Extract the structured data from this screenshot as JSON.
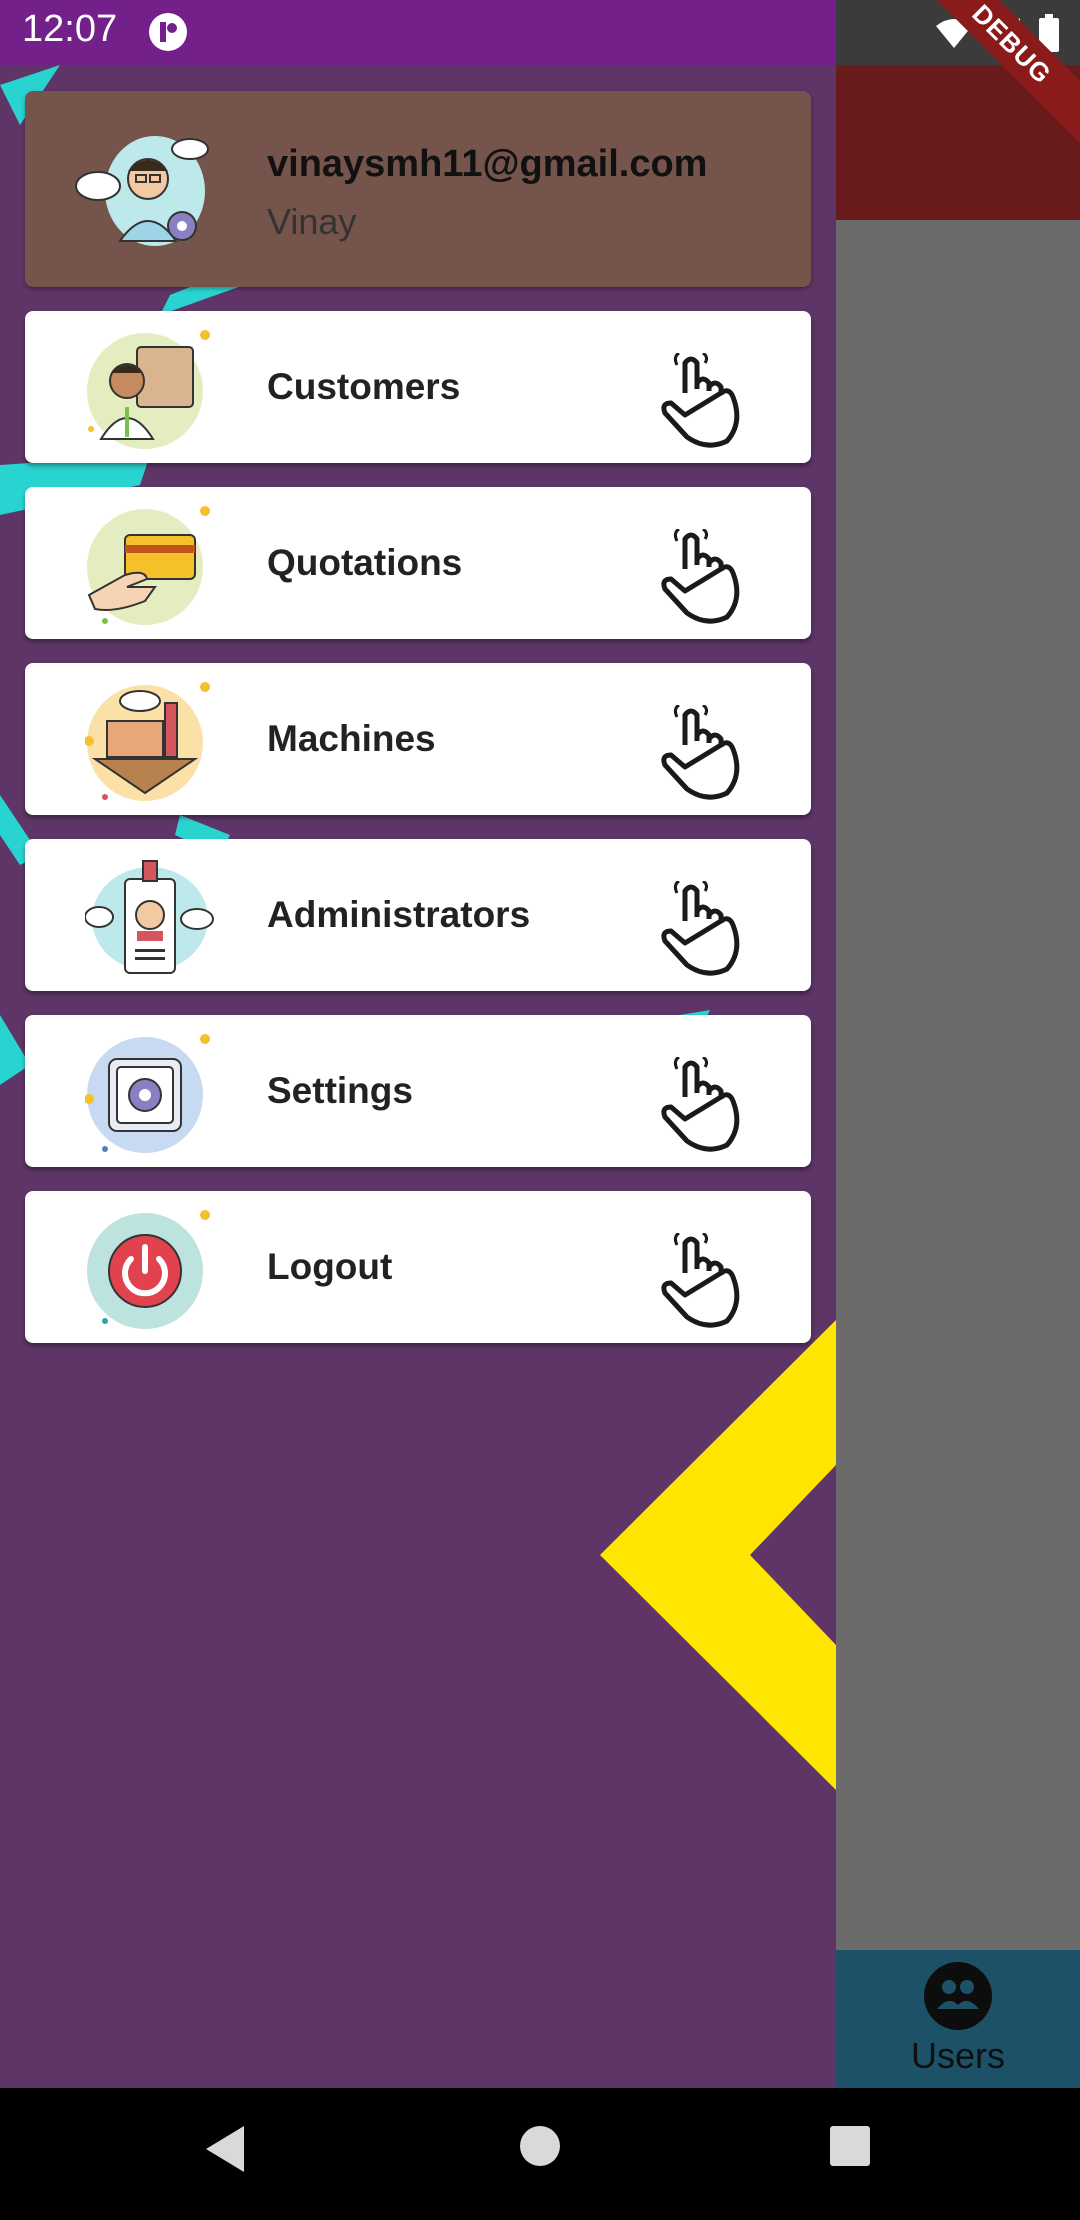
{
  "status_bar": {
    "time": "12:07"
  },
  "debug_banner": "DEBUG",
  "drawer": {
    "header": {
      "email": "vinaysmh11@gmail.com",
      "name": "Vinay"
    },
    "items": [
      {
        "label": "Customers",
        "icon": "customer-icon"
      },
      {
        "label": "Quotations",
        "icon": "credit-card-hand-icon"
      },
      {
        "label": "Machines",
        "icon": "factory-island-icon"
      },
      {
        "label": "Administrators",
        "icon": "id-badge-icon"
      },
      {
        "label": "Settings",
        "icon": "safe-gear-icon"
      },
      {
        "label": "Logout",
        "icon": "power-icon"
      }
    ]
  },
  "bottom_nav": {
    "active_label": "Users"
  },
  "colors": {
    "drawer_bg": "#5e3566",
    "header_card": "#75544c",
    "status_bar": "#74208a",
    "accent_yellow": "#ffe600",
    "accent_cyan": "#29d3d0"
  }
}
